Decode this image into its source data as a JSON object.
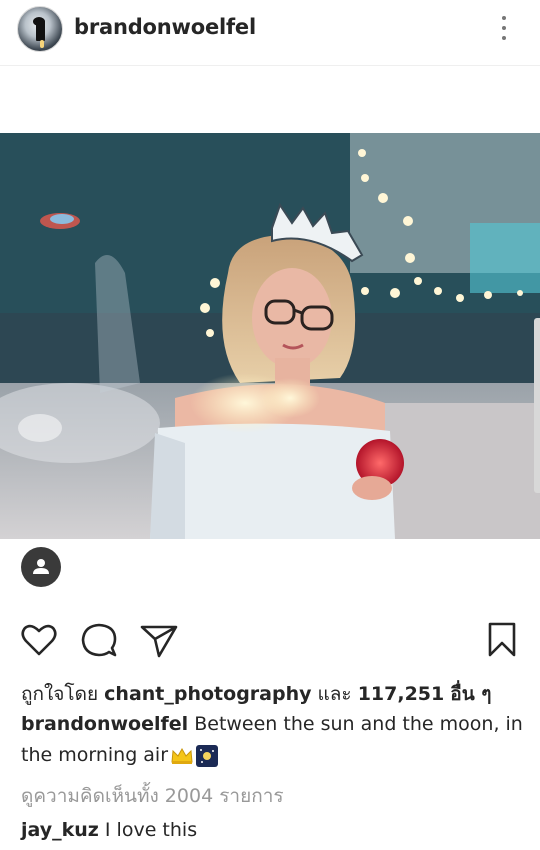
{
  "post": {
    "username": "brandonwoelfel",
    "likes": {
      "prefix": "ถูกใจโดย",
      "liker": "chant_photography",
      "conjunction": "และ",
      "count": "117,251",
      "suffix": "อื่น ๆ"
    },
    "caption": {
      "username": "brandonwoelfel",
      "text": "Between the sun and the moon, in the morning air"
    },
    "view_all_comments": "ดูความคิดเห็นทั้ง 2004 รายการ",
    "comments": [
      {
        "username": "jay_kuz",
        "text": "I love this"
      }
    ]
  },
  "icons": {
    "more": "more-vertical-icon",
    "user_tag": "person-icon",
    "like": "heart-icon",
    "comment": "comment-icon",
    "share": "send-icon",
    "save": "bookmark-icon",
    "caption_emojis": [
      "crown-emoji",
      "night-sky-emoji"
    ]
  },
  "colors": {
    "text": "#262626",
    "muted": "#999999",
    "divider": "#efefef"
  }
}
